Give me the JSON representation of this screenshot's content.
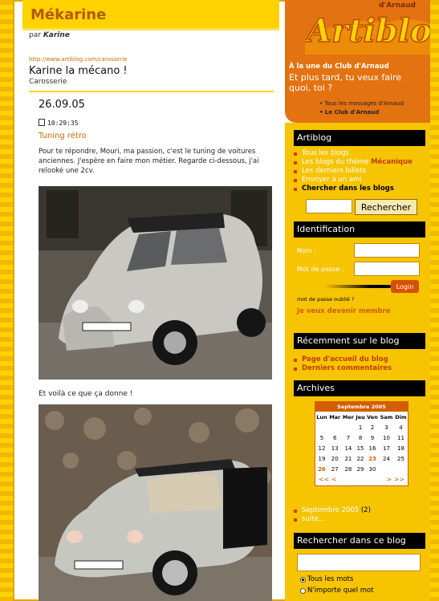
{
  "blog": {
    "title": "Mékarine",
    "by_prefix": "par",
    "author": "Karine"
  },
  "post": {
    "url": "http://www.artiblog.com/carosserie",
    "title": "Karine la mécano !",
    "category": "Carosserie",
    "date": "26.09.05",
    "time": "10:29:35",
    "entry_title": "Tuning rétro",
    "paragraph": "Pour te répondre, Mouri, ma passion, c'est le tuning de voitures anciennes. J'espère en faire mon métier. Regarde ci-dessous, j'ai relooké une 2cv.",
    "caption": "Et voilà ce que ça donne !"
  },
  "brand": {
    "logo": "Artiblog",
    "logo_top": "d'Arnaud",
    "club_small": "À la une du Club d'Arnaud",
    "club_big": "Et plus tard, tu veux faire quoi, toi ?",
    "club_links": [
      "Tous les messages d'Arnaud",
      "Le Club d'Arnaud"
    ]
  },
  "sidebar": {
    "artiblog_head": "Artiblog",
    "artiblog_items": [
      {
        "label": "Tous les blogs"
      },
      {
        "label": "Les blogs du thème ",
        "bold": "Mécanique"
      },
      {
        "label": "Les derniers billets"
      },
      {
        "label": "Envoyer à un ami"
      },
      {
        "label": "Chercher dans les blogs"
      }
    ],
    "search_button": "Rechercher",
    "ident_head": "Identification",
    "nom_label": "Nom :",
    "pass_label": "Mot de passe :",
    "login_button": "Login",
    "forgot": "mot de passe oublié ?",
    "member": "Je veux devenir membre",
    "recent_head": "Récemment sur le blog",
    "recent_items": [
      "Page d'accueil du blog",
      "Derniers commentaires"
    ],
    "archives_head": "Archives",
    "calendar_title": "Septembre 2005",
    "calendar_days": [
      "Lun",
      "Mar",
      "Mer",
      "Jeu",
      "Ven",
      "Sam",
      "Dim"
    ],
    "calendar_rows": [
      [
        "",
        "",
        "",
        "1",
        "2",
        "3",
        "4"
      ],
      [
        "5",
        "6",
        "7",
        "8",
        "9",
        "10",
        "11"
      ],
      [
        "12",
        "13",
        "14",
        "15",
        "16",
        "17",
        "18"
      ],
      [
        "19",
        "20",
        "21",
        "22",
        "23",
        "24",
        "25"
      ],
      [
        "26",
        "27",
        "28",
        "29",
        "30",
        "",
        ""
      ]
    ],
    "calendar_highlight": [
      "23",
      "26"
    ],
    "cal_nav_left": "<< <",
    "cal_nav_right": "> >>",
    "archive_month": "Septembre 2005",
    "archive_count": "(2)",
    "archive_more": "suite...",
    "search_blog_head": "Rechercher dans ce blog",
    "radio_options": [
      "Tous les mots",
      "N'importe quel mot"
    ]
  },
  "colors": {
    "yellow": "#f6c400",
    "orange": "#e37210",
    "accent": "#d25e00"
  }
}
